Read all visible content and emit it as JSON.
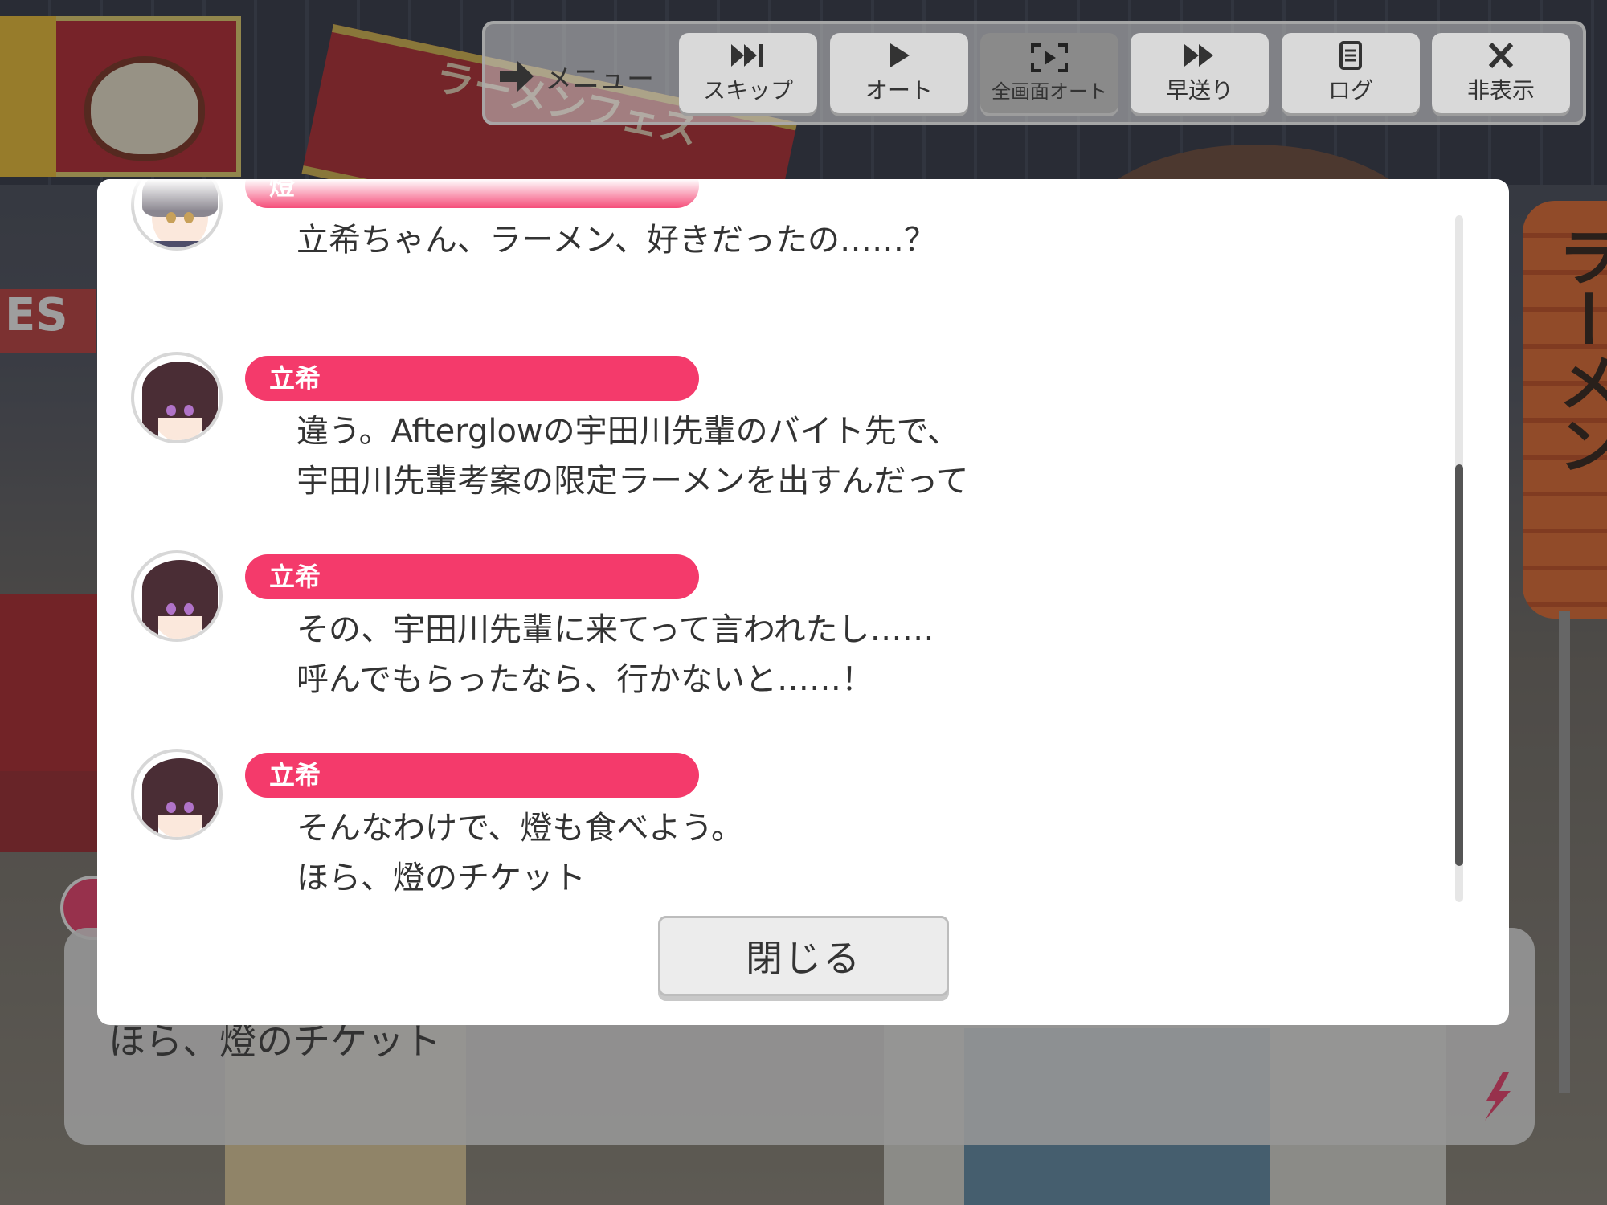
{
  "toolbar": {
    "menu_label": "メニュー",
    "buttons": [
      {
        "label": "スキップ",
        "icon": "skip-icon"
      },
      {
        "label": "オート",
        "icon": "play-icon"
      },
      {
        "label": "全画面オート",
        "icon": "fullscreen-auto-icon",
        "active": true
      },
      {
        "label": "早送り",
        "icon": "fast-forward-icon"
      },
      {
        "label": "ログ",
        "icon": "log-icon"
      },
      {
        "label": "非表示",
        "icon": "close-x-icon"
      }
    ]
  },
  "background": {
    "banner_text": "ラーメンフェス",
    "sign_text": "ES",
    "lantern_text": "ラーメン",
    "dialogue_text": "ほら、燈のチケット"
  },
  "log": {
    "entries": [
      {
        "speaker": "燈",
        "text": "立希ちゃん、ラーメン、好きだったの……？"
      },
      {
        "speaker": "立希",
        "text": "違う。Afterglowの宇田川先輩のバイト先で、\n宇田川先輩考案の限定ラーメンを出すんだって"
      },
      {
        "speaker": "立希",
        "text": "その、宇田川先輩に来てって言われたし……\n呼んでもらったなら、行かないと……！"
      },
      {
        "speaker": "立希",
        "text": "そんなわけで、燈も食べよう。\nほら、燈のチケット"
      }
    ],
    "close_label": "閉じる"
  },
  "colors": {
    "name_pill": "#f43a6b",
    "modal_bg": "#ffffff",
    "active_button": "#8a8a8a"
  }
}
